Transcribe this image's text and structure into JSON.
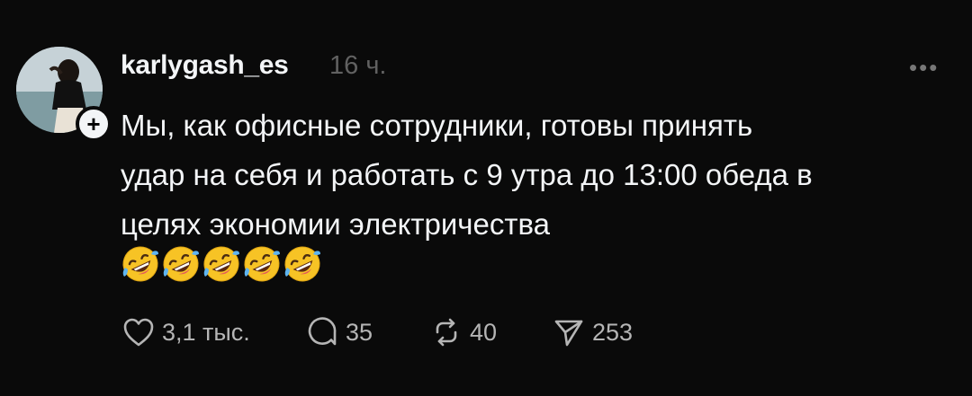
{
  "post": {
    "username": "karlygash_es",
    "timestamp": "16 ч.",
    "more_label": "•••",
    "text": "Мы, как офисные сотрудники, готовы принять\nудар на себя и работать с 9 утра до 13:00 обеда в\nцелях экономии электричества",
    "emoji_name": "rolling-on-the-floor-laughing",
    "emoji_count": 5
  },
  "actions": {
    "likes": "3,1 тыс.",
    "replies": "35",
    "reposts": "40",
    "shares": "253"
  },
  "colors": {
    "background": "#0a0a0a",
    "text": "#f3f5f7",
    "muted": "#616161",
    "counts": "#b5b5b5"
  }
}
